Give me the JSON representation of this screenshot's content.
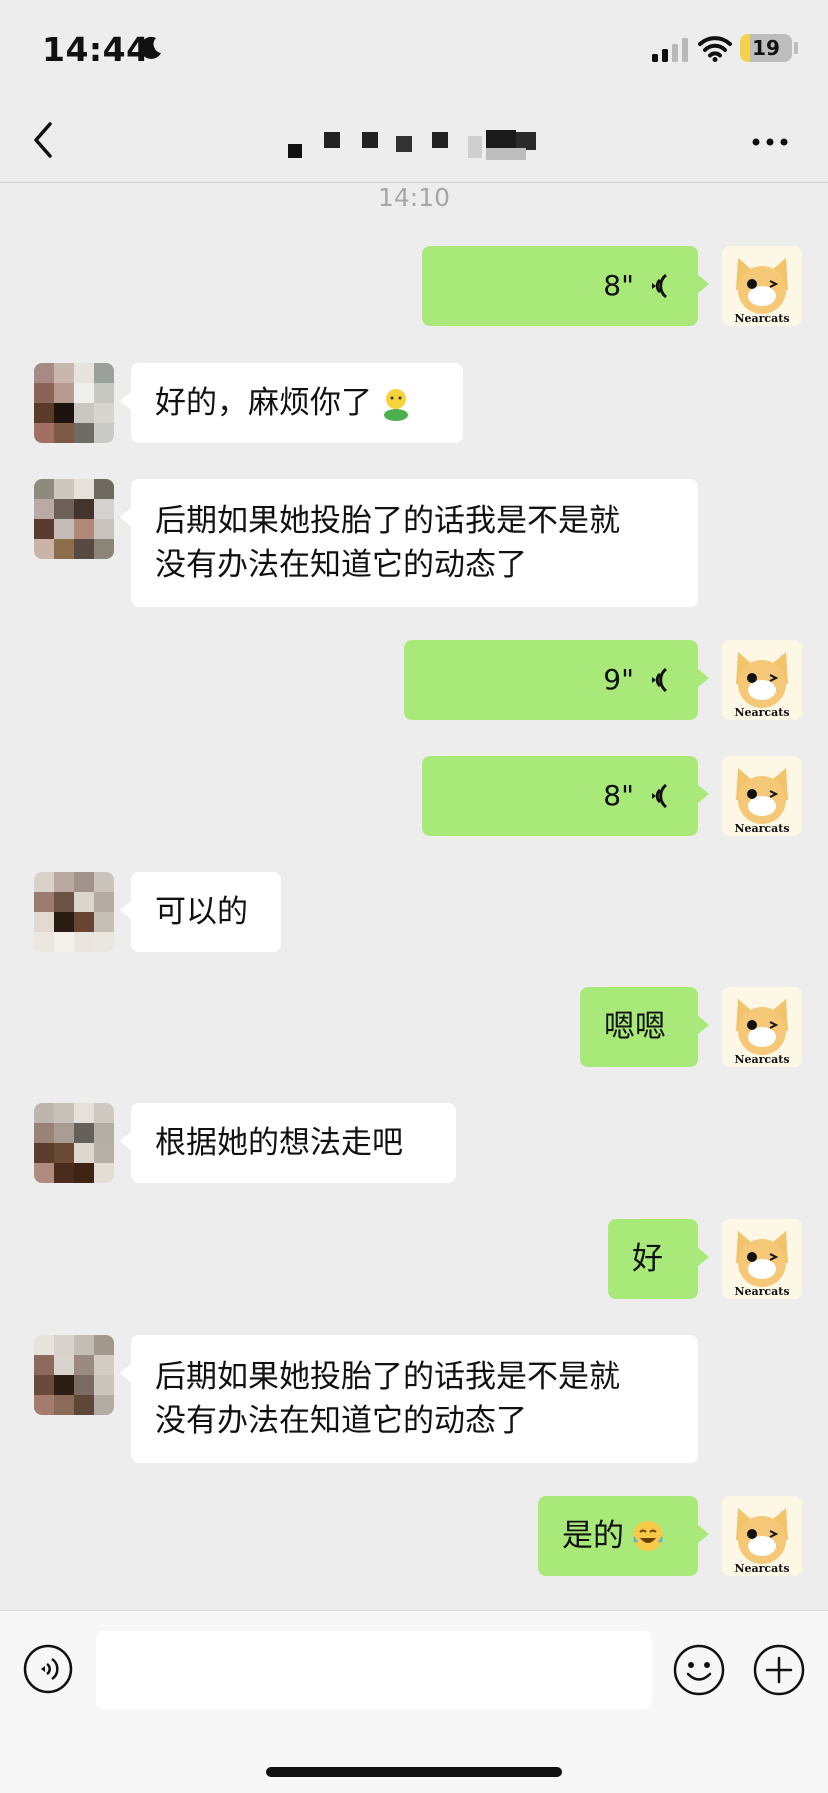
{
  "status_bar": {
    "time": "14:44",
    "battery_level": "19",
    "battery_fraction": 0.19
  },
  "nav": {
    "back_icon": "chevron-left-icon",
    "more_icon": "ellipsis-icon"
  },
  "chat": {
    "timestamp": "14:10",
    "messages": [
      {
        "sender": "me",
        "type": "voice",
        "duration": "8\""
      },
      {
        "sender": "other",
        "type": "text",
        "text": "好的，麻烦你了"
      },
      {
        "sender": "other",
        "type": "text",
        "lines": [
          "后期如果她投胎了的话我是不是就",
          "没有办法在知道它的动态了"
        ]
      },
      {
        "sender": "me",
        "type": "voice",
        "duration": "9\""
      },
      {
        "sender": "me",
        "type": "voice",
        "duration": "8\""
      },
      {
        "sender": "other",
        "type": "text",
        "text": "可以的"
      },
      {
        "sender": "me",
        "type": "text",
        "text": "嗯嗯"
      },
      {
        "sender": "other",
        "type": "text",
        "text": "根据她的想法走吧"
      },
      {
        "sender": "me",
        "type": "text",
        "text": "好"
      },
      {
        "sender": "other",
        "type": "text",
        "lines": [
          "后期如果她投胎了的话我是不是就",
          "没有办法在知道它的动态了"
        ]
      },
      {
        "sender": "me",
        "type": "text",
        "text": "是的"
      }
    ],
    "my_avatar_text": "Nearcats"
  },
  "input_bar": {
    "input_value": "",
    "voice_icon": "voice-input-icon",
    "emoji_icon": "emoji-icon",
    "plus_icon": "plus-icon"
  },
  "colors": {
    "my_bubble": "#a9e97a",
    "other_bubble": "#ffffff",
    "background": "#ededed"
  }
}
